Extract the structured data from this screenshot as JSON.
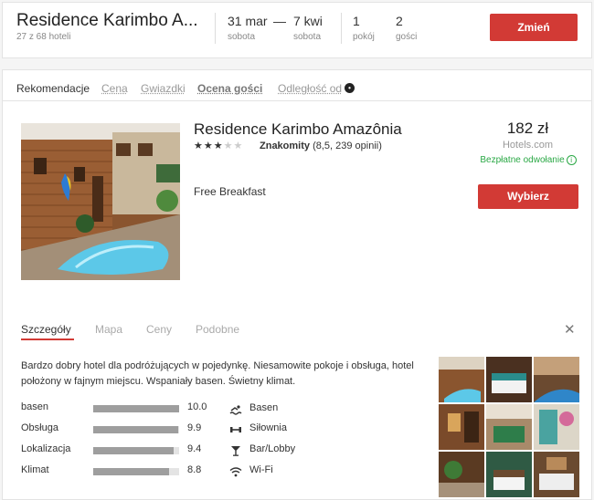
{
  "header": {
    "hotel_name": "Residence Karimbo A...",
    "hotel_count": "27 z 68 hoteli",
    "checkin_date": "31 mar",
    "checkin_day": "sobota",
    "dash": "—",
    "checkout_date": "7 kwi",
    "checkout_day": "sobota",
    "rooms_value": "1",
    "rooms_label": "pokój",
    "guests_value": "2",
    "guests_label": "gości",
    "change_button": "Zmień"
  },
  "sort": {
    "label": "Rekomendacje",
    "options": [
      "Cena",
      "Gwiazdki",
      "Ocena gości",
      "Odległość od"
    ],
    "active": "Ocena gości"
  },
  "result": {
    "name": "Residence Karimbo Amazônia",
    "stars_total": 5,
    "stars_filled": 3,
    "rating_word": "Znakomity",
    "rating_detail": "(8,5, 239 opinii)",
    "amenity_text": "Free Breakfast",
    "price": "182 zł",
    "provider": "Hotels.com",
    "free_cancellation": "Bezpłatne odwołanie",
    "select_button": "Wybierz"
  },
  "tabs": [
    "Szczegóły",
    "Mapa",
    "Ceny",
    "Podobne"
  ],
  "active_tab": "Szczegóły",
  "details": {
    "description": "Bardzo dobry hotel dla podróżujących w pojedynkę. Niesamowite pokoje i obsługa, hotel położony w fajnym miejscu. Wspaniały basen. Świetny klimat.",
    "scores": [
      {
        "label": "basen",
        "value": "10.0",
        "fraction": 1.0
      },
      {
        "label": "Obsługa",
        "value": "9.9",
        "fraction": 0.99
      },
      {
        "label": "Lokalizacja",
        "value": "9.4",
        "fraction": 0.94
      },
      {
        "label": "Klimat",
        "value": "8.8",
        "fraction": 0.88
      }
    ],
    "amenities": [
      {
        "label": "Basen",
        "icon": "pool-icon"
      },
      {
        "label": "Siłownia",
        "icon": "dumbbell-icon"
      },
      {
        "label": "Bar/Lobby",
        "icon": "cocktail-icon"
      },
      {
        "label": "Wi-Fi",
        "icon": "wifi-icon"
      }
    ]
  },
  "colors": {
    "accent": "#d23a35",
    "success": "#2aa845"
  }
}
